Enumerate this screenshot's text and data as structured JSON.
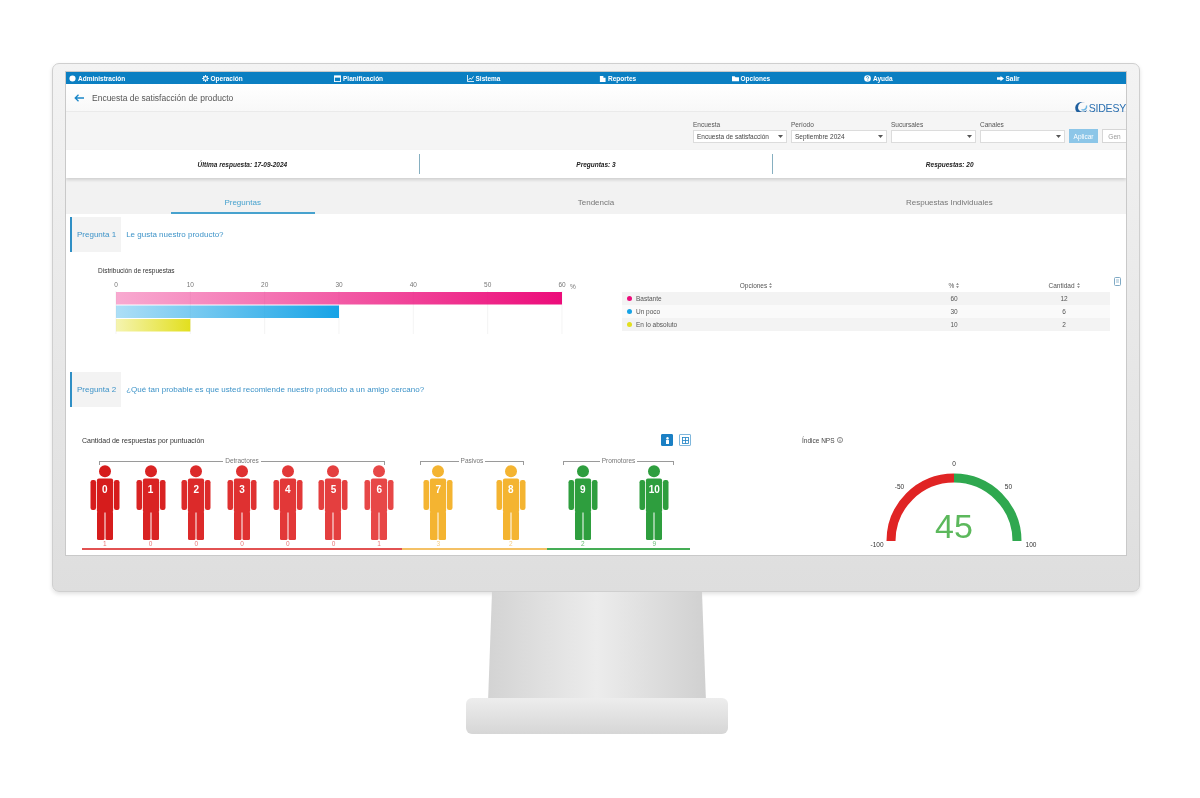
{
  "menu_bar": [
    "Administración",
    "Operación",
    "Planificación",
    "Sistema",
    "Reportes",
    "Opciones",
    "Ayuda",
    "Salir"
  ],
  "header": {
    "title": "Encuesta de satisfacción de producto",
    "logo": "SIDESY"
  },
  "filters": [
    {
      "label": "Encuesta",
      "value": "Encuesta de satisfacción"
    },
    {
      "label": "Período",
      "value": "Septiembre 2024"
    },
    {
      "label": "Sucursales"
    },
    {
      "label": "Canales"
    }
  ],
  "filter_buttons": [
    {
      "label": "Aplicar",
      "kind": "primary"
    },
    {
      "label": "Gen",
      "kind": "secondary"
    }
  ],
  "summary": [
    "Última respuesta: 17-09-2024",
    "Preguntas: 3",
    "Respuestas: 20"
  ],
  "tabs": [
    {
      "label": "Preguntas",
      "selected": true
    },
    {
      "label": "Tendencia",
      "selected": false
    },
    {
      "label": "Respuestas Individuales",
      "selected": false
    }
  ],
  "questions": [
    {
      "kind": "options",
      "number": "Pregunta 1",
      "text": "Le gusta nuestro producto?",
      "chart_data": {
        "type": "bar",
        "title": "Distribución de respuestas",
        "orientation": "horizontal",
        "values": [
          60,
          30,
          10
        ],
        "xlim": [
          0,
          60
        ],
        "xticks": [
          0,
          10,
          20,
          30,
          40,
          50,
          60
        ],
        "xlabel": "%",
        "grid": true
      },
      "table": {
        "columns": [
          "Opciones",
          "%",
          "Cantidad"
        ],
        "rows": [
          {
            "option": "Bastante",
            "color": "#ec0c7a",
            "percent": "60",
            "count": "12"
          },
          {
            "option": "Un poco",
            "color": "#16a3e6",
            "percent": "30",
            "count": "6"
          },
          {
            "option": "En lo absoluto",
            "color": "#e2df1e",
            "percent": "10",
            "count": "2"
          }
        ]
      }
    },
    {
      "kind": "nps",
      "number": "Pregunta 2",
      "text": "¿Qué tan probable es que usted recomiende nuestro producto a un amigo cercano?",
      "distribution": {
        "title": "Cantidad de respuestas por puntuación",
        "view_buttons": [
          {
            "selected": true
          },
          {
            "selected": false
          }
        ],
        "groups": [
          {
            "label": "Detractores",
            "color": "#e25252",
            "scores": [
              {
                "score": "0",
                "count": "1",
                "color": "#d61c1c"
              },
              {
                "score": "1",
                "count": "0",
                "color": "#d92323"
              },
              {
                "score": "2",
                "count": "0",
                "color": "#dc2a2a"
              },
              {
                "score": "3",
                "count": "0",
                "color": "#df3131"
              },
              {
                "score": "4",
                "count": "0",
                "color": "#e23838"
              },
              {
                "score": "5",
                "count": "0",
                "color": "#e43f3f"
              },
              {
                "score": "6",
                "count": "1",
                "color": "#e74747"
              }
            ]
          },
          {
            "label": "Pasivos",
            "color": "#f4c165",
            "scores": [
              {
                "score": "7",
                "count": "3",
                "color": "#f4b431"
              },
              {
                "score": "8",
                "count": "2",
                "color": "#f4b431"
              }
            ]
          },
          {
            "label": "Promotores",
            "color": "#45ad55",
            "scores": [
              {
                "score": "9",
                "count": "2",
                "color": "#2e9e3e"
              },
              {
                "score": "10",
                "count": "9",
                "color": "#2e9e3e"
              }
            ]
          }
        ]
      },
      "nps": {
        "title": "Índice NPS",
        "value": "45",
        "ticks": [
          "-100",
          "-50",
          "0",
          "50",
          "100"
        ]
      }
    }
  ]
}
